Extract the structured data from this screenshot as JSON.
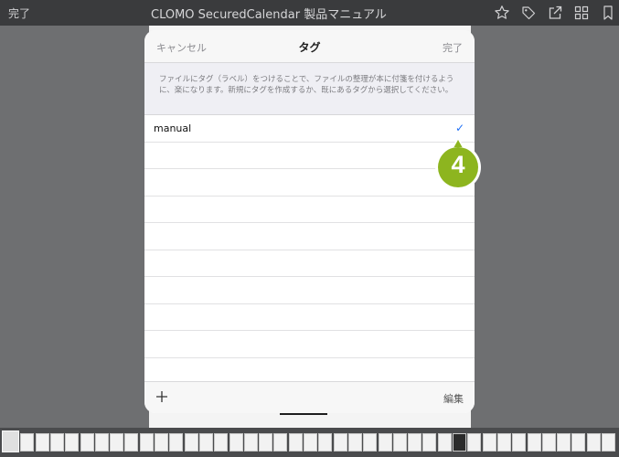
{
  "toolbar": {
    "done_label": "完了",
    "title": "CLOMO SecuredCalendar 製品マニュアル",
    "icons": [
      "star-icon",
      "tag-icon",
      "share-icon",
      "grid-icon",
      "bookmark-icon"
    ]
  },
  "dialog": {
    "cancel_label": "キャンセル",
    "title": "タグ",
    "done_label": "完了",
    "description": "ファイルにタグ（ラベル）をつけることで、ファイルの整理が本に付箋を付けるように、楽になります。新規にタグを作成するか、既にあるタグから選択してください。",
    "tags": [
      {
        "label": "manual",
        "checked": true
      },
      {
        "label": "",
        "checked": false
      },
      {
        "label": "",
        "checked": false
      },
      {
        "label": "",
        "checked": false
      },
      {
        "label": "",
        "checked": false
      },
      {
        "label": "",
        "checked": false
      },
      {
        "label": "",
        "checked": false
      },
      {
        "label": "",
        "checked": false
      },
      {
        "label": "",
        "checked": false
      },
      {
        "label": "",
        "checked": false
      }
    ],
    "check_mark": "✓",
    "add_label": "+",
    "edit_label": "編集"
  },
  "callout": {
    "step_number": "4",
    "color": "#8db51f"
  },
  "colors": {
    "accent": "#1e6ff5",
    "toolbar_bg": "#3a3b3d",
    "backdrop": "#6e6f71"
  }
}
